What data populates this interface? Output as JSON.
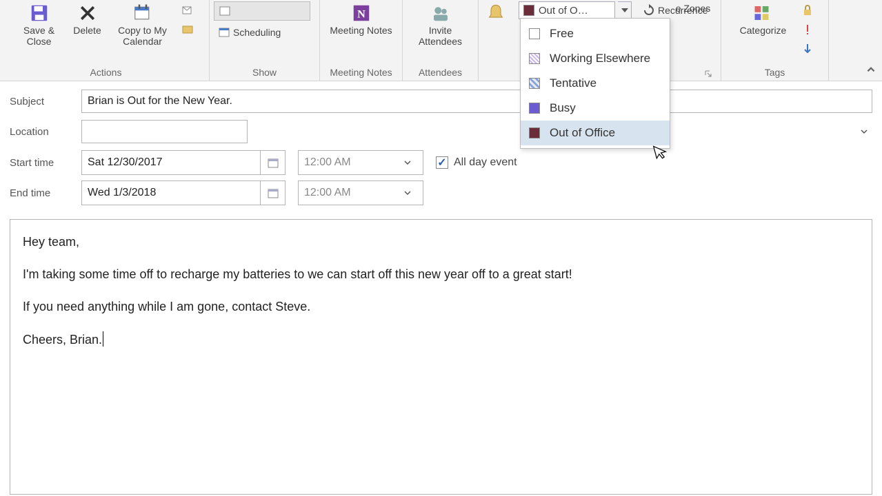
{
  "ribbon": {
    "save_close": "Save & Close",
    "delete": "Delete",
    "copy_calendar": "Copy to My Calendar",
    "scheduling": "Scheduling",
    "meeting_notes": "Meeting Notes",
    "invite_attendees": "Invite Attendees",
    "recurrence": "Recurrence",
    "time_zones": "e Zones",
    "categorize": "Categorize",
    "groups": {
      "actions": "Actions",
      "show": "Show",
      "meeting_notes": "Meeting Notes",
      "attendees": "Attendees",
      "tags": "Tags"
    },
    "show_as": {
      "selected_label": "Out of O…",
      "options": [
        {
          "key": "free",
          "label": "Free"
        },
        {
          "key": "we",
          "label": "Working Elsewhere"
        },
        {
          "key": "tent",
          "label": "Tentative"
        },
        {
          "key": "busy",
          "label": "Busy"
        },
        {
          "key": "ooo",
          "label": "Out of Office"
        }
      ],
      "hover_key": "ooo"
    }
  },
  "form": {
    "subject_label": "Subject",
    "subject_value": "Brian is Out for the New Year.",
    "location_label": "Location",
    "location_value": "",
    "start_label": "Start time",
    "start_date": "Sat 12/30/2017",
    "start_time": "12:00 AM",
    "end_label": "End time",
    "end_date": "Wed 1/3/2018",
    "end_time": "12:00 AM",
    "all_day_label": "All day event",
    "all_day_checked": true
  },
  "body": {
    "p1": "Hey team,",
    "p2": "I'm taking some time off to recharge my batteries to we can start off this new year off to a great start!",
    "p3": "If you need anything while I am gone, contact Steve.",
    "p4": "Cheers, Brian."
  }
}
